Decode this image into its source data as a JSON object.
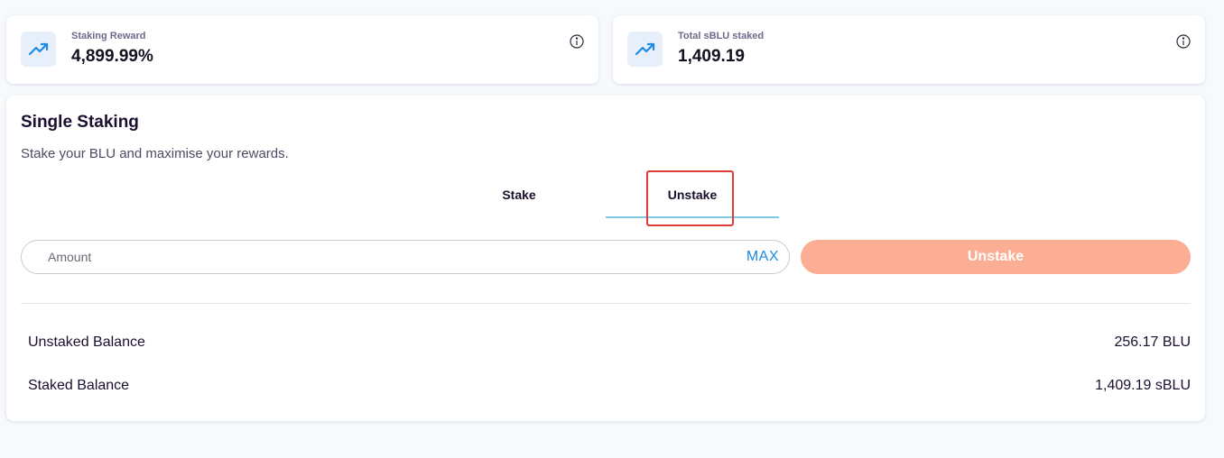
{
  "stats": [
    {
      "label": "Staking Reward",
      "value": "4,899.99%",
      "icon": "trending-up-icon",
      "info_icon": "info-icon"
    },
    {
      "label": "Total sBLU staked",
      "value": "1,409.19",
      "icon": "trending-up-icon",
      "info_icon": "info-icon"
    }
  ],
  "staking": {
    "title": "Single Staking",
    "subtitle": "Stake your BLU and maximise your rewards.",
    "tabs": [
      {
        "label": "Stake",
        "active": false
      },
      {
        "label": "Unstake",
        "active": true
      }
    ],
    "amount": {
      "placeholder": "Amount",
      "value": "",
      "max_label": "MAX"
    },
    "action_label": "Unstake",
    "balances": [
      {
        "label": "Unstaked Balance",
        "value": "256.17 BLU"
      },
      {
        "label": "Staked Balance",
        "value": "1,409.19 sBLU"
      }
    ]
  },
  "colors": {
    "accent_blue": "#1a8be0",
    "tab_underline": "#7ec8e3",
    "action_button": "#fcae95",
    "highlight_box": "#e03b3b"
  }
}
